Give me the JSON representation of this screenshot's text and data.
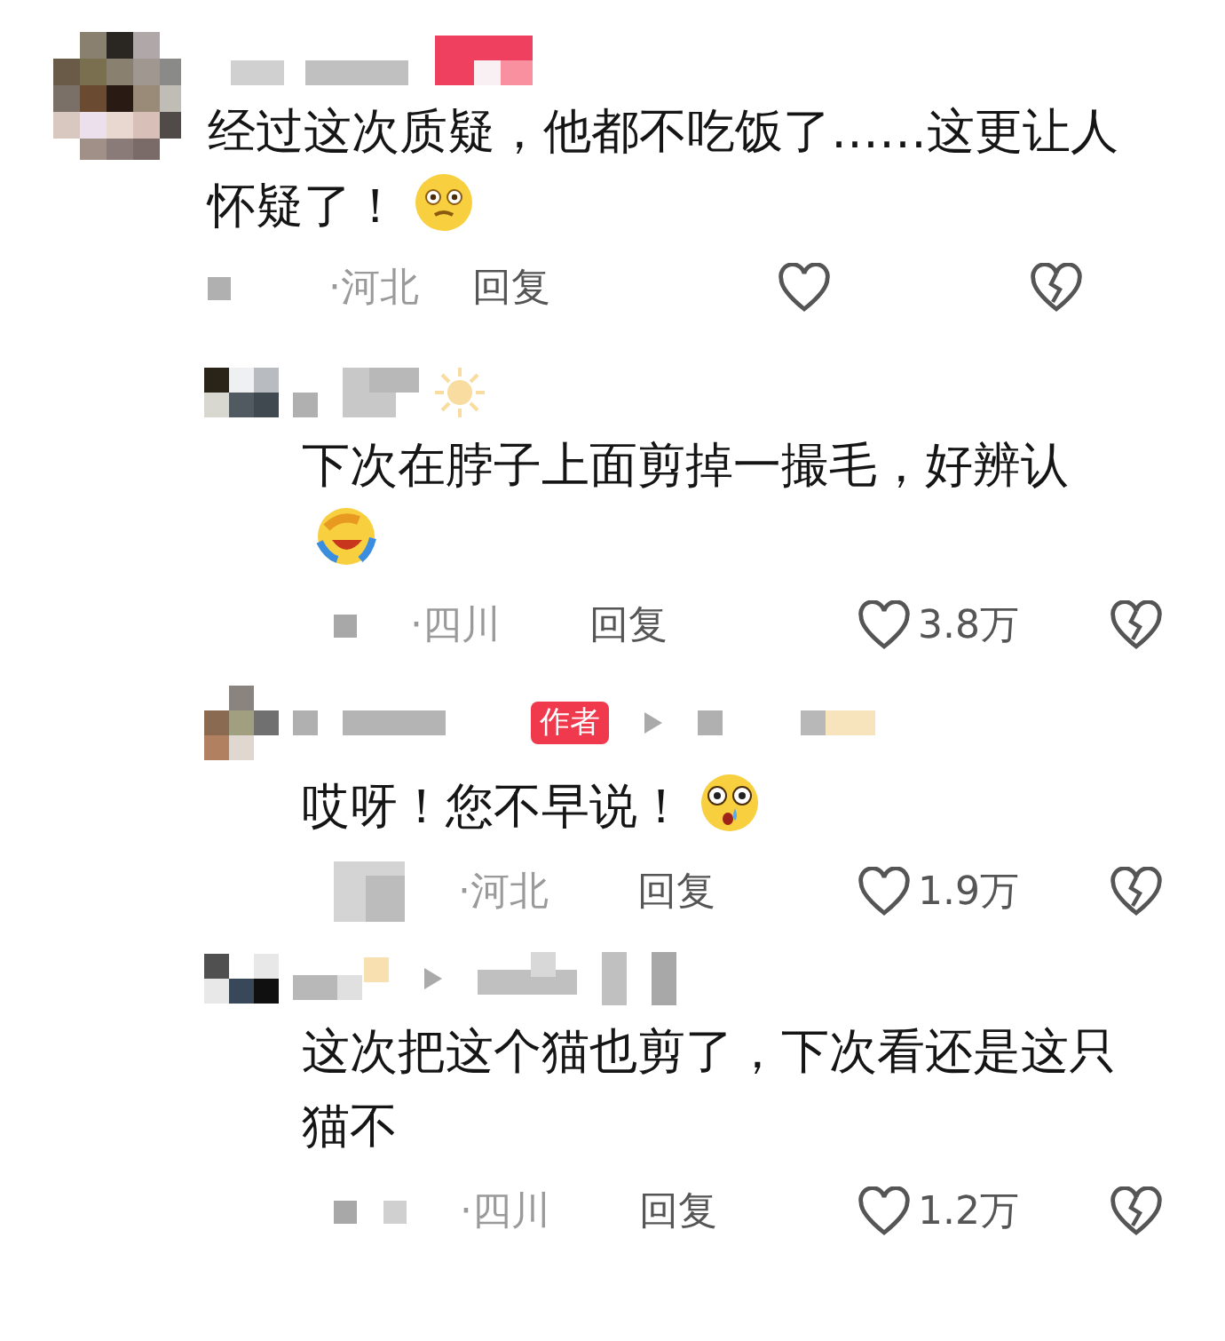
{
  "comments": [
    {
      "text": "经过这次质疑，他都不吃饭了……这更让人怀疑了！",
      "has_emoji": true,
      "location": "·河北",
      "reply": "回复",
      "replies": [
        {
          "text": "下次在脖子上面剪掉一撮毛，好辨认",
          "has_emoji": true,
          "location": "·四川",
          "reply": "回复",
          "likes": "3.8万"
        },
        {
          "badge": "作者",
          "text": "哎呀！您不早说！",
          "has_emoji": true,
          "location": "·河北",
          "reply": "回复",
          "likes": "1.9万"
        },
        {
          "text": "这次把这个猫也剪了，下次看还是这只猫不",
          "has_emoji": false,
          "location": "·四川",
          "reply": "回复",
          "likes": "1.2万"
        }
      ]
    }
  ]
}
